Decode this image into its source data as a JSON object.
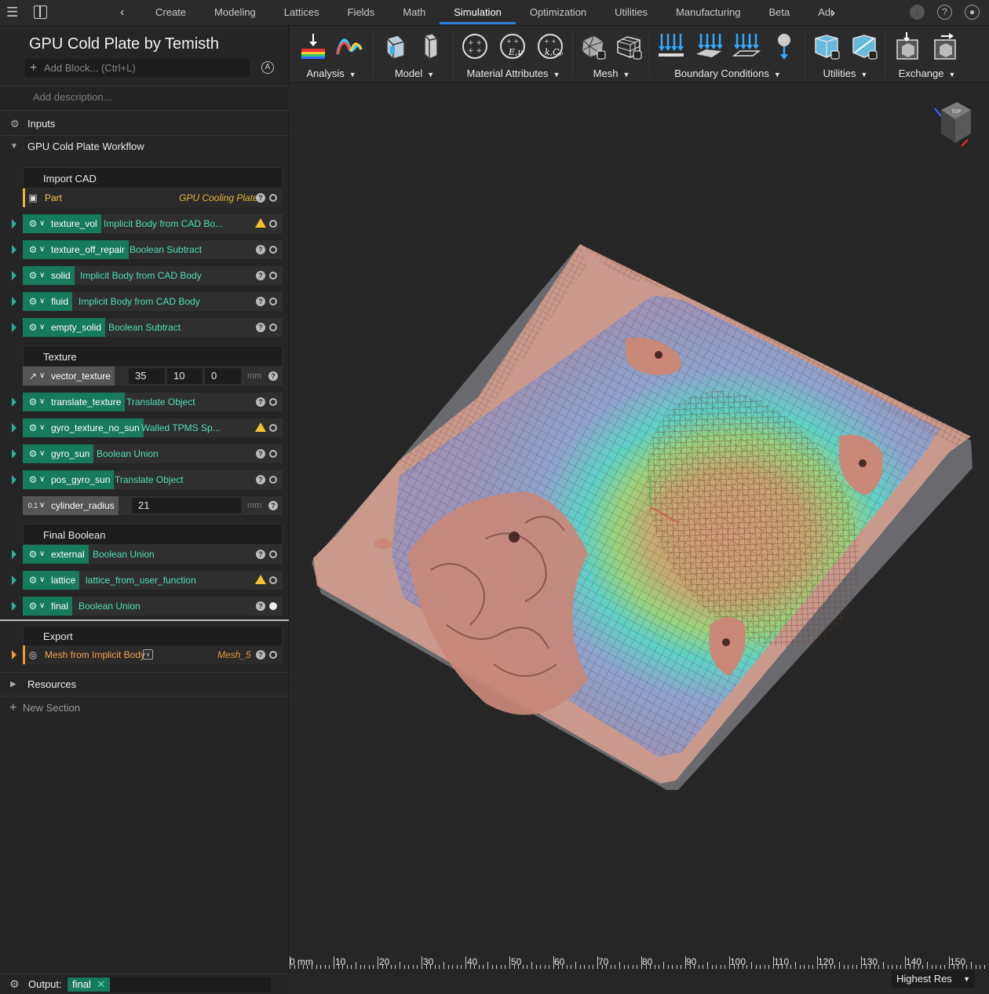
{
  "topbar": {
    "menu_icon": "hamburger-icon",
    "panel_icon": "panel-toggle-icon",
    "back_icon": "chevron-left-icon",
    "forward_icon": "chevron-right-icon",
    "tabs": [
      "Create",
      "Modeling",
      "Lattices",
      "Fields",
      "Math",
      "Simulation",
      "Optimization",
      "Utilities",
      "Manufacturing",
      "Beta",
      "Additi"
    ],
    "active_tab": "Simulation",
    "right_icons": [
      "download-icon",
      "help-icon",
      "account-icon"
    ]
  },
  "notebook": {
    "title": "GPU Cold Plate by Temisth",
    "add_block_placeholder": "Add Block... (Ctrl+L)",
    "description_placeholder": "Add description...",
    "inputs_label": "Inputs",
    "workflow_label": "GPU Cold Plate Workflow",
    "groups": {
      "import_cad": "Import CAD",
      "texture": "Texture",
      "final_boolean": "Final Boolean",
      "export": "Export"
    },
    "part": {
      "name": "Part",
      "value": "GPU Cooling Plate"
    },
    "blocks": [
      {
        "name": "texture_vol",
        "op": "Implicit Body from CAD Bo...",
        "status": "warning"
      },
      {
        "name": "texture_off_repair",
        "op": "Boolean Subtract",
        "status": "help"
      },
      {
        "name": "solid",
        "op": "Implicit Body from CAD Body",
        "status": "help"
      },
      {
        "name": "fluid",
        "op": "Implicit Body from CAD Body",
        "status": "help"
      },
      {
        "name": "empty_solid",
        "op": "Boolean Subtract",
        "status": "help"
      },
      {
        "name": "translate_texture",
        "op": "Translate Object",
        "status": "help"
      },
      {
        "name": "gyro_texture_no_sun",
        "op": "Walled TPMS Sp...",
        "status": "warning"
      },
      {
        "name": "gyro_sun",
        "op": "Boolean Union",
        "status": "help"
      },
      {
        "name": "pos_gyro_sun",
        "op": "Translate Object",
        "status": "help"
      },
      {
        "name": "external",
        "op": "Boolean Union",
        "status": "help"
      },
      {
        "name": "lattice",
        "op": "lattice_from_user_function",
        "status": "warning"
      },
      {
        "name": "final",
        "op": "Boolean Union",
        "status": "help"
      }
    ],
    "vector_texture": {
      "name": "vector_texture",
      "x": "35",
      "y": "10",
      "z": "0",
      "unit": "mm"
    },
    "cylinder_radius": {
      "name": "cylinder_radius",
      "badge": "0.1",
      "value": "21",
      "unit": "mm"
    },
    "export_block": {
      "name": "Mesh from Implicit Body",
      "value": "Mesh_5"
    },
    "resources_label": "Resources",
    "new_section_label": "New Section",
    "output_label": "Output:",
    "output_value": "final"
  },
  "ribbon": {
    "groups": [
      "Analysis",
      "Model",
      "Material Attributes",
      "Mesh",
      "Boundary Conditions",
      "Utilities",
      "Exchange"
    ],
    "symbols": {
      "material_2": "E,ν",
      "material_3": "k,Cₚ"
    }
  },
  "viewport": {
    "view_cube_label": "TOP",
    "ruler_labels": [
      "0 mm",
      "10",
      "20",
      "30",
      "40",
      "50",
      "60",
      "70",
      "80",
      "90",
      "100",
      "110",
      "120",
      "130",
      "140",
      "150"
    ],
    "resolution": "Highest Res"
  },
  "colors": {
    "accent": "#2f7fd6",
    "block_tag": "#177a5c",
    "operation_text": "#4fe0b8",
    "part_accent": "#e3b83a",
    "export_accent": "#e89a3a",
    "warning": "#f2c230"
  }
}
